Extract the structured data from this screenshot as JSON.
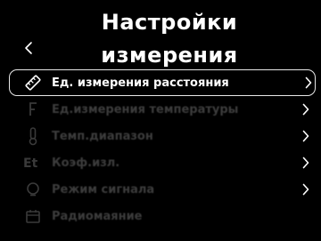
{
  "header": {
    "title_line1": "Настройки",
    "title_line2": "измерения",
    "back_icon": "chevron-left-icon"
  },
  "menu": {
    "items": [
      {
        "label": "Ед. измерения расстояния",
        "icon": "ruler-icon",
        "selected": true
      },
      {
        "label": "Ед.измерения температуры",
        "icon": "temperature-unit-icon",
        "selected": false
      },
      {
        "label": "Темп.диапазон",
        "icon": "thermometer-icon",
        "selected": false
      },
      {
        "label": "Коэф.изл.",
        "icon": "emissivity-icon",
        "selected": false
      },
      {
        "label": "Режим сигнала",
        "icon": "alarm-icon",
        "selected": false
      },
      {
        "label": "Радиомаяние",
        "icon": "calendar-icon",
        "selected": false
      }
    ]
  },
  "colors": {
    "background": "#000000",
    "text": "#ffffff",
    "dim_text": "#3c3c3c",
    "selection_border": "#e8e8e8"
  }
}
